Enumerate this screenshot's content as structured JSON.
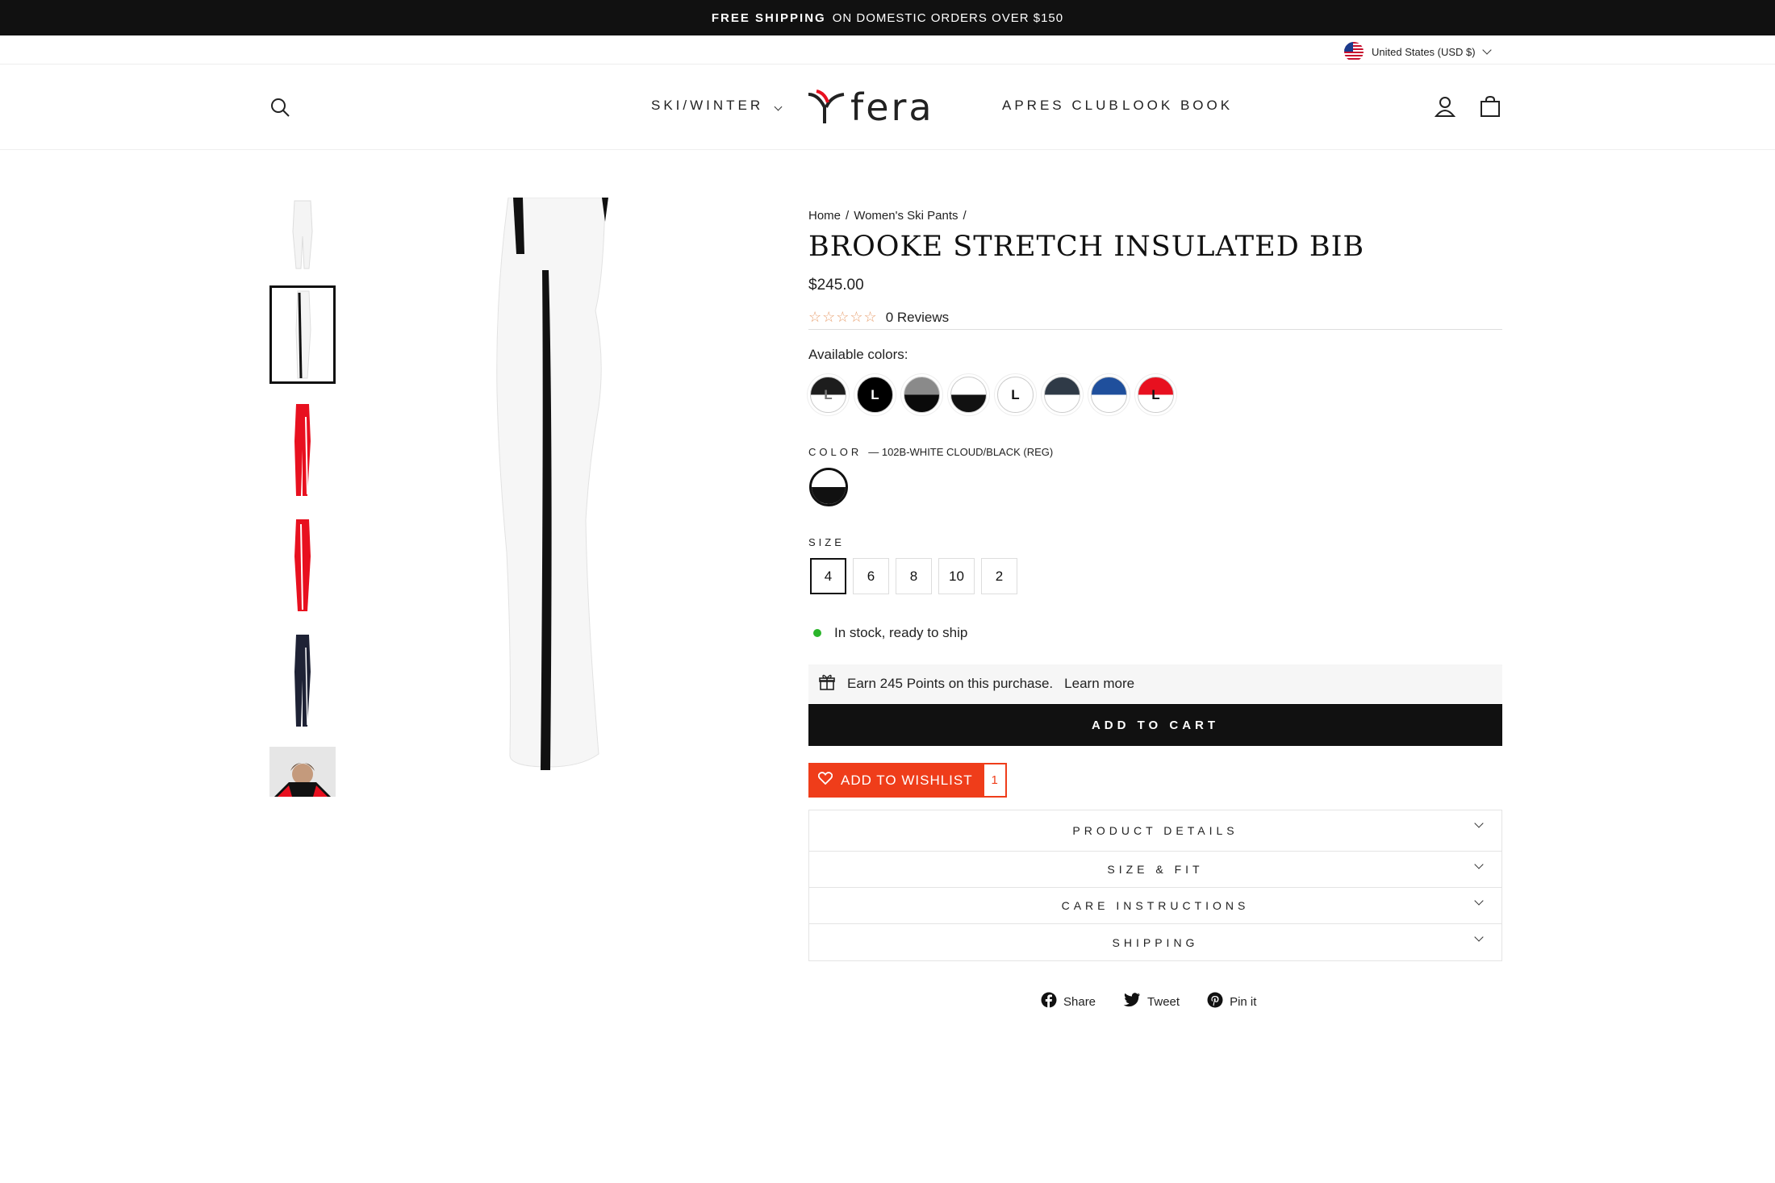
{
  "announcement": {
    "bold": "FREE SHIPPING",
    "text": "ON DOMESTIC ORDERS OVER $150"
  },
  "currency": {
    "label": "United States (USD $)"
  },
  "nav": {
    "ski_winter": "SKI/WINTER",
    "logo": "fera",
    "apres_club": "APRES CLUB",
    "look_book": "LOOK BOOK",
    "icons": [
      "search-icon",
      "account-icon",
      "cart-icon"
    ]
  },
  "breadcrumb": {
    "home": "Home",
    "sep1": "/",
    "category": "Women's Ski Pants",
    "sep2": "/"
  },
  "product": {
    "title": "BROOKE STRETCH INSULATED BIB",
    "price": "$245.00",
    "reviews": "0 Reviews",
    "rating": 0,
    "available_colors_label": "Available colors:",
    "color_label": "COLOR",
    "color_value": "— 102B-WHITE CLOUD/BLACK (REG)",
    "size_label": "SIZE",
    "sizes": [
      "4",
      "6",
      "8",
      "10",
      "2"
    ],
    "selected_size": "4",
    "stock": "In stock, ready to ship",
    "points_text": "Earn 245 Points on this purchase.",
    "points_link": "Learn more",
    "add_to_cart": "ADD TO CART",
    "wishlist_label": "ADD TO WISHLIST",
    "wishlist_count": "1"
  },
  "swatches": [
    {
      "top": "#1d1d1d",
      "bottom": "#ffffff",
      "letter": "L",
      "letter_color": "#777"
    },
    {
      "top": "#000000",
      "bottom": "#000000",
      "letter": "L",
      "letter_color": "#ffffff"
    },
    {
      "top": "#8a8a8a",
      "bottom": "#0a0a0a",
      "letter": "",
      "letter_color": "#fff"
    },
    {
      "top": "#ffffff",
      "bottom": "#111111",
      "letter": "",
      "letter_color": "#fff"
    },
    {
      "top": "#ffffff",
      "bottom": "#ffffff",
      "letter": "L",
      "letter_color": "#111"
    },
    {
      "top": "#2f3a47",
      "bottom": "#ffffff",
      "letter": "",
      "letter_color": "#fff"
    },
    {
      "top": "#1f4f9c",
      "bottom": "#ffffff",
      "letter": "",
      "letter_color": "#fff"
    },
    {
      "top": "#e8101f",
      "bottom": "#ffffff",
      "letter": "L",
      "letter_color": "#111"
    }
  ],
  "accordion": [
    "PRODUCT DETAILS",
    "SIZE & FIT",
    "CARE INSTRUCTIONS",
    "SHIPPING"
  ],
  "share": {
    "facebook": "Share",
    "twitter": "Tweet",
    "pinterest": "Pin it"
  },
  "colors": {
    "accent": "#ef3d1a",
    "stock": "#2bb52b",
    "dark": "#111111"
  }
}
